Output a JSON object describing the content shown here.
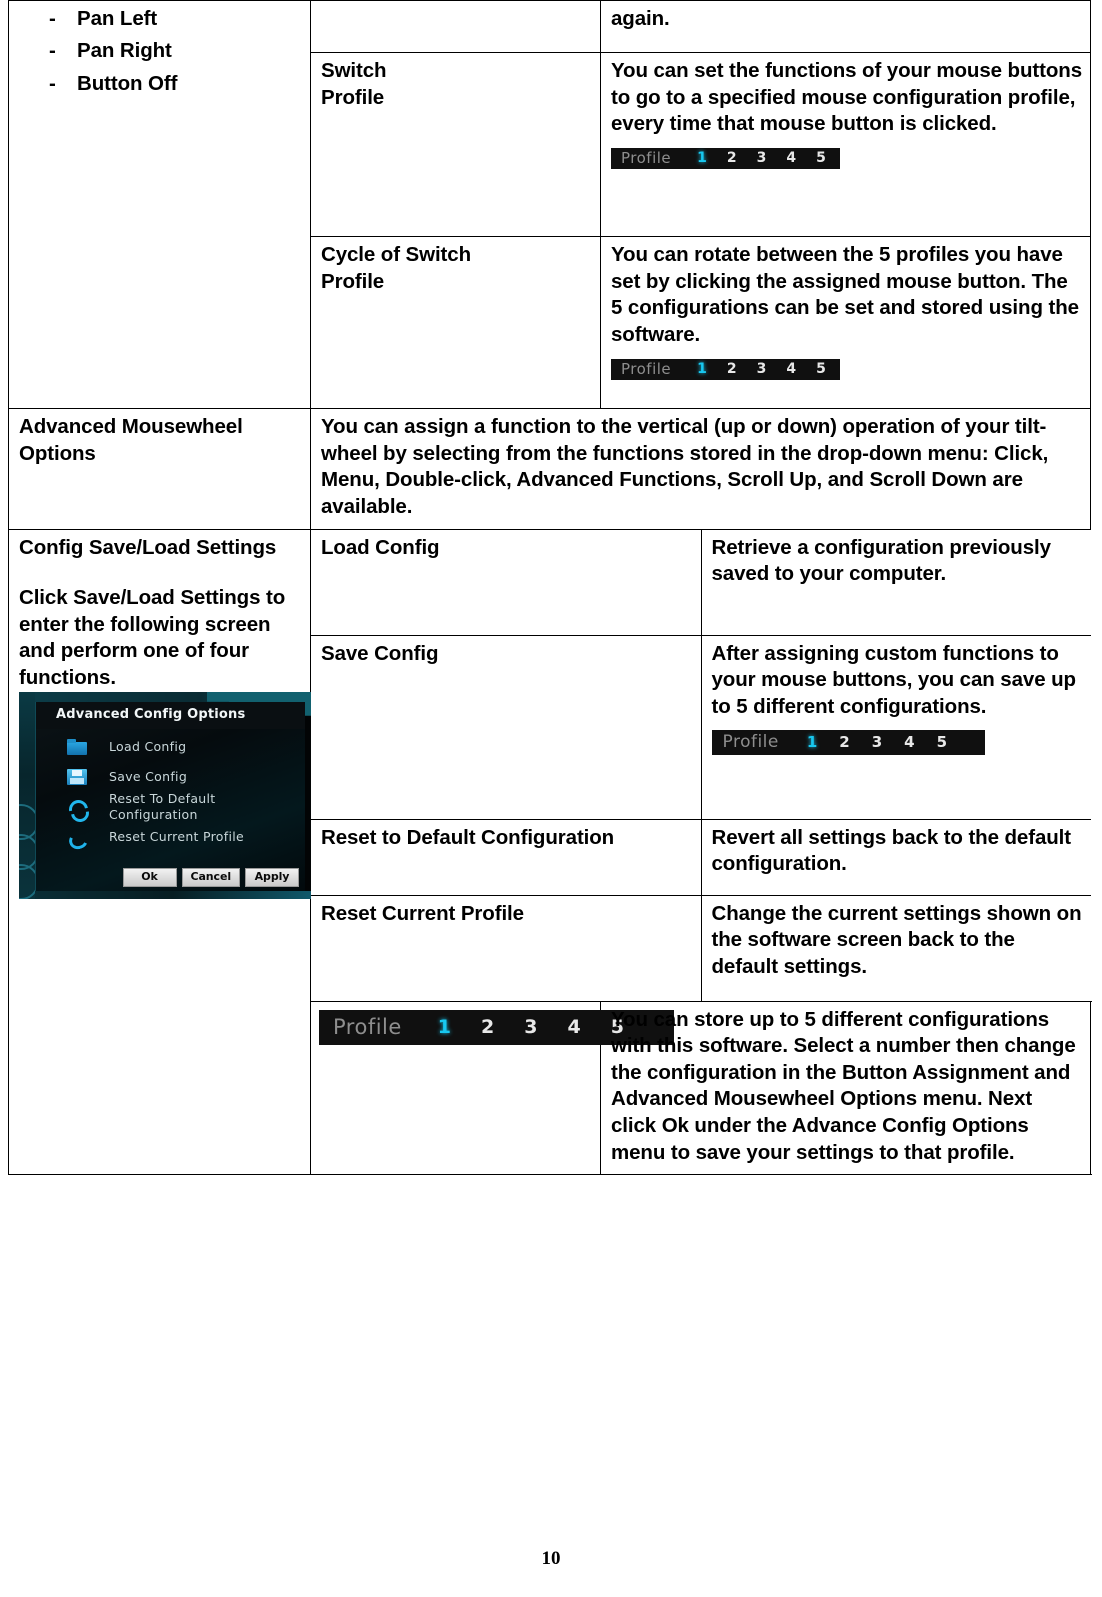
{
  "document": {
    "page_number": "10"
  },
  "top_section": {
    "bullets": [
      {
        "dash": "-",
        "label": "Pan Left"
      },
      {
        "dash": "-",
        "label": "Pan Right"
      },
      {
        "dash": "-",
        "label": "Button Off"
      }
    ],
    "carryover_text": "again.",
    "rows": [
      {
        "name": "Switch\nProfile",
        "description": "You can set the functions of your mouse buttons to go to a specified mouse configuration profile, every time that mouse button is clicked.",
        "has_profile_widget": true
      },
      {
        "name": "Cycle of Switch\nProfile",
        "description": "You can rotate between the 5 profiles you have set by clicking the assigned mouse button. The 5 configurations can be set and stored using the software.",
        "has_profile_widget": true
      }
    ]
  },
  "mousewheel_section": {
    "title": "Advanced Mousewheel Options",
    "description": "You can assign a function to the vertical (up or down) operation of your tilt-wheel by selecting from the functions stored in the drop-down menu: Click, Menu, Double-click, Advanced Functions, Scroll Up, and Scroll Down are available."
  },
  "config_section": {
    "title": "Config Save/Load Settings",
    "intro": "Click Save/Load Settings to enter the following screen and perform one of four functions.",
    "rows": [
      {
        "name": "Load Config",
        "description": "Retrieve a configuration previously saved to your computer.",
        "has_profile_widget": false
      },
      {
        "name": "Save Config",
        "description": "After assigning custom functions to your mouse buttons, you can save up to 5 different configurations.",
        "has_profile_widget": true
      },
      {
        "name": "Reset to Default Configuration",
        "description": "Revert all settings back to the default configuration.",
        "has_profile_widget": false
      },
      {
        "name": "Reset Current Profile",
        "description": "Change the current settings shown on the software screen back to the default settings.",
        "has_profile_widget": false
      }
    ]
  },
  "bottom_section": {
    "description": "You can store up to 5 different configurations with this software. Select a number then change the configuration in the Button Assignment and Advanced Mousewheel Options menu. Next click Ok under the Advance Config Options menu to save your settings to that profile."
  },
  "profile_widget": {
    "label": "Profile",
    "numbers": [
      "1",
      "2",
      "3",
      "4",
      "5"
    ],
    "selected": "1",
    "colors": {
      "background": "#101010",
      "label_color": "#8e8e8e",
      "number_color": "#e8e8e8",
      "active_color": "#18c8f0"
    }
  },
  "advanced_config_dialog": {
    "title": "Advanced Config Options",
    "items": [
      {
        "icon": "folder-icon",
        "label": "Load Config"
      },
      {
        "icon": "floppy-disk-icon",
        "label": "Save Config"
      },
      {
        "icon": "refresh-icon",
        "label": "Reset To Default Configuration"
      },
      {
        "icon": "undo-arrow-icon",
        "label": "Reset Current Profile"
      }
    ],
    "buttons": [
      {
        "label": "Ok"
      },
      {
        "label": "Cancel"
      },
      {
        "label": "Apply"
      }
    ],
    "colors": {
      "accent": "#12616f",
      "icon_blue": "#21b6ec",
      "background": "#040b0e"
    }
  }
}
